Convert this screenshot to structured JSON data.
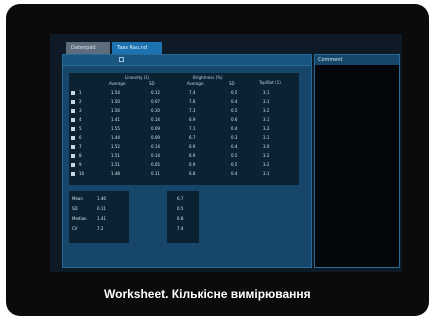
{
  "tabs": [
    "Datenpäd",
    "Taas Rau.nd"
  ],
  "side_panel_title": "Comment",
  "caption": "Worksheet. Кількісне вимірювання",
  "table": {
    "group_headers": [
      "Linearity (1)",
      "Brightness (%)",
      "Top/Bot (1)"
    ],
    "sub_headers": [
      "Average",
      "SD",
      "Average",
      "SD"
    ],
    "rows": [
      {
        "id": "1",
        "vals": [
          "1.54",
          "0.12",
          "7.4",
          "0.5",
          "3.1"
        ]
      },
      {
        "id": "2",
        "vals": [
          "1.50",
          "0.07",
          "7.6",
          "0.4",
          "3.1"
        ]
      },
      {
        "id": "3",
        "vals": [
          "1.56",
          "0.10",
          "7.3",
          "0.5",
          "3.2"
        ]
      },
      {
        "id": "4",
        "vals": [
          "1.41",
          "0.14",
          "6.9",
          "0.6",
          "3.1"
        ]
      },
      {
        "id": "5",
        "vals": [
          "1.55",
          "0.09",
          "7.1",
          "0.4",
          "3.2"
        ]
      },
      {
        "id": "6",
        "vals": [
          "1.44",
          "0.09",
          "6.7",
          "0.3",
          "3.1"
        ]
      },
      {
        "id": "7",
        "vals": [
          "1.52",
          "0.14",
          "6.9",
          "0.4",
          "3.0"
        ]
      },
      {
        "id": "8",
        "vals": [
          "1.51",
          "0.14",
          "6.9",
          "0.5",
          "3.2"
        ]
      },
      {
        "id": "9",
        "vals": [
          "1.51",
          "0.05",
          "6.9",
          "0.5",
          "3.2"
        ]
      },
      {
        "id": "10",
        "vals": [
          "1.48",
          "0.11",
          "6.8",
          "0.4",
          "3.1"
        ]
      }
    ]
  },
  "stats": [
    {
      "label": "Mean",
      "a": "1.46",
      "b": "6.7"
    },
    {
      "label": "SD",
      "a": "0.11",
      "b": "0.5"
    },
    {
      "label": "Median",
      "a": "1.41",
      "b": "6.8"
    },
    {
      "label": "CV",
      "a": "7.2",
      "b": "7.4"
    }
  ]
}
